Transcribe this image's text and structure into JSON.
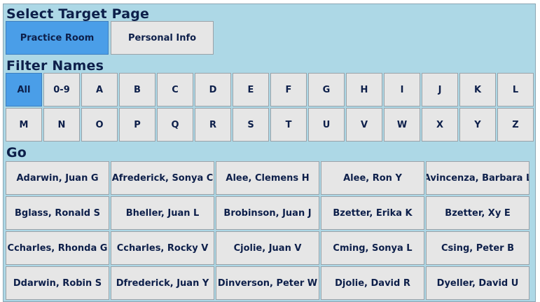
{
  "sections": {
    "target_heading": "Select Target Page",
    "filter_heading": "Filter Names",
    "go_heading": "Go"
  },
  "target_pages": [
    {
      "label": "Practice Room",
      "selected": true
    },
    {
      "label": "Personal Info",
      "selected": false
    }
  ],
  "filters_row1": [
    {
      "label": "All",
      "selected": true
    },
    {
      "label": "0-9"
    },
    {
      "label": "A"
    },
    {
      "label": "B"
    },
    {
      "label": "C"
    },
    {
      "label": "D"
    },
    {
      "label": "E"
    },
    {
      "label": "F"
    },
    {
      "label": "G"
    },
    {
      "label": "H"
    },
    {
      "label": "I"
    },
    {
      "label": "J"
    },
    {
      "label": "K"
    },
    {
      "label": "L"
    }
  ],
  "filters_row2": [
    {
      "label": "M"
    },
    {
      "label": "N"
    },
    {
      "label": "O"
    },
    {
      "label": "P"
    },
    {
      "label": "Q"
    },
    {
      "label": "R"
    },
    {
      "label": "S"
    },
    {
      "label": "T"
    },
    {
      "label": "U"
    },
    {
      "label": "V"
    },
    {
      "label": "W"
    },
    {
      "label": "X"
    },
    {
      "label": "Y"
    },
    {
      "label": "Z"
    }
  ],
  "names": [
    [
      "Adarwin, Juan G",
      "Afrederick, Sonya C",
      "Alee, Clemens H",
      "Alee, Ron Y",
      "Avincenza, Barbara L"
    ],
    [
      "Bglass, Ronald S",
      "Bheller, Juan L",
      "Brobinson, Juan J",
      "Bzetter, Erika K",
      "Bzetter, Xy E"
    ],
    [
      "Ccharles, Rhonda G",
      "Ccharles, Rocky V",
      "Cjolie, Juan V",
      "Cming, Sonya L",
      "Csing, Peter B"
    ],
    [
      "Ddarwin, Robin S",
      "Dfrederick, Juan Y",
      "Dinverson, Peter W",
      "Djolie, David R",
      "Dyeller, David U"
    ]
  ],
  "colors": {
    "background": "#add8e6",
    "selected": "#4a9ee8",
    "button": "#e6e6e6",
    "text": "#0d1f4a"
  }
}
